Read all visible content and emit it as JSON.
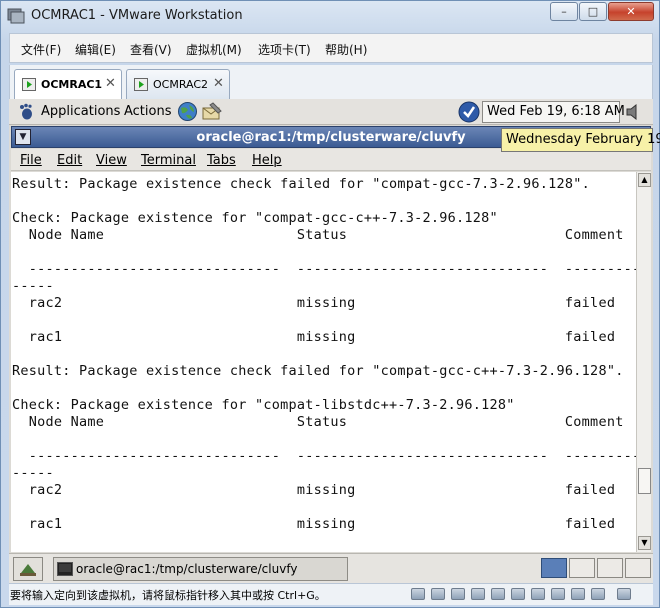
{
  "window": {
    "title": "OCMRAC1 - VMware Workstation"
  },
  "vm_menu": [
    "文件(F)",
    "编辑(E)",
    "查看(V)",
    "虚拟机(M)",
    "选项卡(T)",
    "帮助(H)"
  ],
  "tabs": [
    {
      "label": "OCMRAC1",
      "active": true
    },
    {
      "label": "OCMRAC2",
      "active": false
    }
  ],
  "guest_panel": {
    "applications": "Applications",
    "actions": "Actions",
    "clock": "Wed Feb 19,  6:18 AM",
    "tooltip": "Wednesday February 19"
  },
  "terminal": {
    "title": "oracle@rac1:/tmp/clusterware/cluvfy",
    "menu": [
      "File",
      "Edit",
      "View",
      "Terminal",
      "Tabs",
      "Help"
    ],
    "lines": [
      "Result: Package existence check failed for \"compat-gcc-7.3-2.96.128\".",
      "",
      "Check: Package existence for \"compat-gcc-c++-7.3-2.96.128\"",
      "  Node Name                       Status                          Comment",
      "",
      "  ------------------------------  ------------------------------  ----------",
      "-----",
      "  rac2                            missing                         failed",
      "",
      "  rac1                            missing                         failed",
      "",
      "Result: Package existence check failed for \"compat-gcc-c++-7.3-2.96.128\".",
      "",
      "Check: Package existence for \"compat-libstdc++-7.3-2.96.128\"",
      "  Node Name                       Status                          Comment",
      "",
      "  ------------------------------  ------------------------------  ----------",
      "-----",
      "  rac2                            missing                         failed",
      "",
      "  rac1                            missing                         failed"
    ]
  },
  "taskbar": {
    "item": "oracle@rac1:/tmp/clusterware/cluvfy"
  },
  "statusbar": {
    "text": "要将输入定向到该虚拟机，请将鼠标指针移入其中或按 Ctrl+G。"
  },
  "colors": {
    "terminal_title": "#3b5b93",
    "tooltip": "#f7f1a8",
    "close_button": "#c6422c"
  }
}
